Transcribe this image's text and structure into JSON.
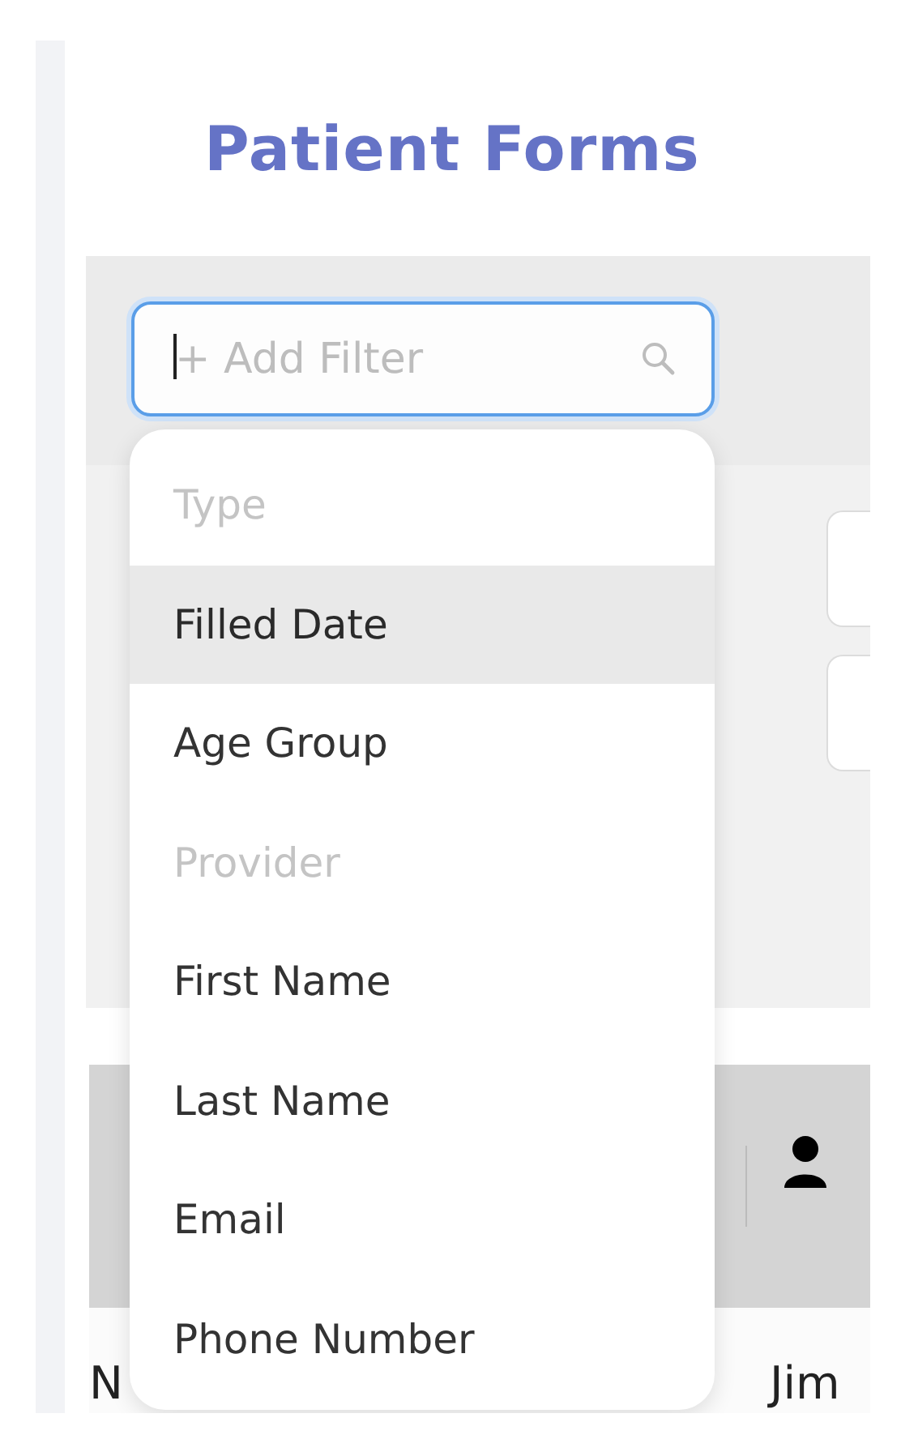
{
  "page": {
    "title": "Patient Forms"
  },
  "filter": {
    "placeholder": "+ Add Filter",
    "focused": true,
    "menu": [
      {
        "label": "Type",
        "disabled": true,
        "selected": false
      },
      {
        "label": "Filled Date",
        "disabled": false,
        "selected": true
      },
      {
        "label": "Age Group",
        "disabled": false,
        "selected": false
      },
      {
        "label": "Provider",
        "disabled": true,
        "selected": false
      },
      {
        "label": "First Name",
        "disabled": false,
        "selected": false
      },
      {
        "label": "Last Name",
        "disabled": false,
        "selected": false
      },
      {
        "label": "Email",
        "disabled": false,
        "selected": false
      },
      {
        "label": "Phone Number",
        "disabled": false,
        "selected": false
      }
    ]
  },
  "table": {
    "rows": [
      {
        "cells": [
          "N",
          "Jim"
        ]
      }
    ]
  }
}
